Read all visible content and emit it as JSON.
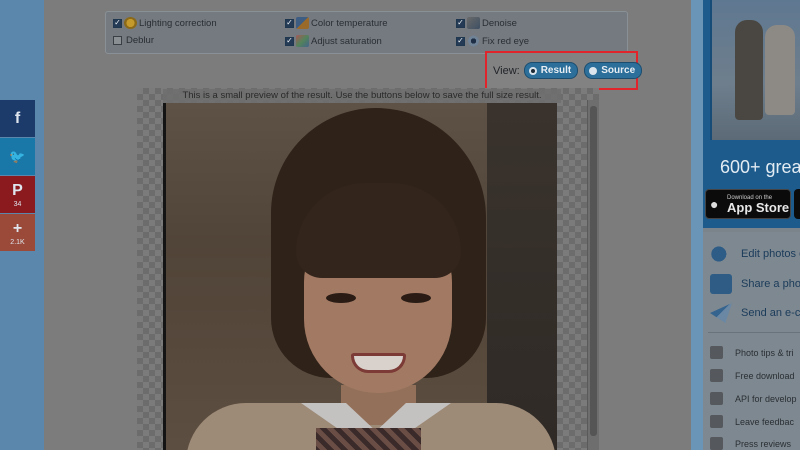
{
  "options": [
    {
      "label": "Lighting correction",
      "checked": true,
      "icon": "lighting-icon"
    },
    {
      "label": "Color temperature",
      "checked": true,
      "icon": "color-temperature-icon"
    },
    {
      "label": "Denoise",
      "checked": true,
      "icon": "denoise-icon"
    },
    {
      "label": "Deblur",
      "checked": false,
      "icon": ""
    },
    {
      "label": "Adjust saturation",
      "checked": true,
      "icon": "saturation-icon"
    },
    {
      "label": "Fix red eye",
      "checked": true,
      "icon": "eye-icon"
    }
  ],
  "view": {
    "label": "View:",
    "result_label": "Result",
    "source_label": "Source",
    "selected": "Result"
  },
  "preview": {
    "note": "This is a small preview of the result. Use the buttons below to save the full size result."
  },
  "share": {
    "facebook_glyph": "f",
    "twitter_glyph": "🐦",
    "pinterest_glyph": "P",
    "pinterest_count": "34",
    "plus_glyph": "+",
    "plus_count": "2.1K"
  },
  "sidebar": {
    "promo_text": "600+ grea",
    "appstore_small": "Download on the",
    "appstore_big": "App Store",
    "main_items": [
      "Edit photos o",
      "Share a phot",
      "Send an e-ca"
    ],
    "small_items": [
      "Photo tips & tri",
      "Free download",
      "API for develop",
      "Leave feedbac",
      "Press reviews"
    ]
  },
  "colors": {
    "highlight_border": "#e1232b",
    "toggle_button": "#2c6f9b",
    "ad_background": "#1d5b8c"
  }
}
